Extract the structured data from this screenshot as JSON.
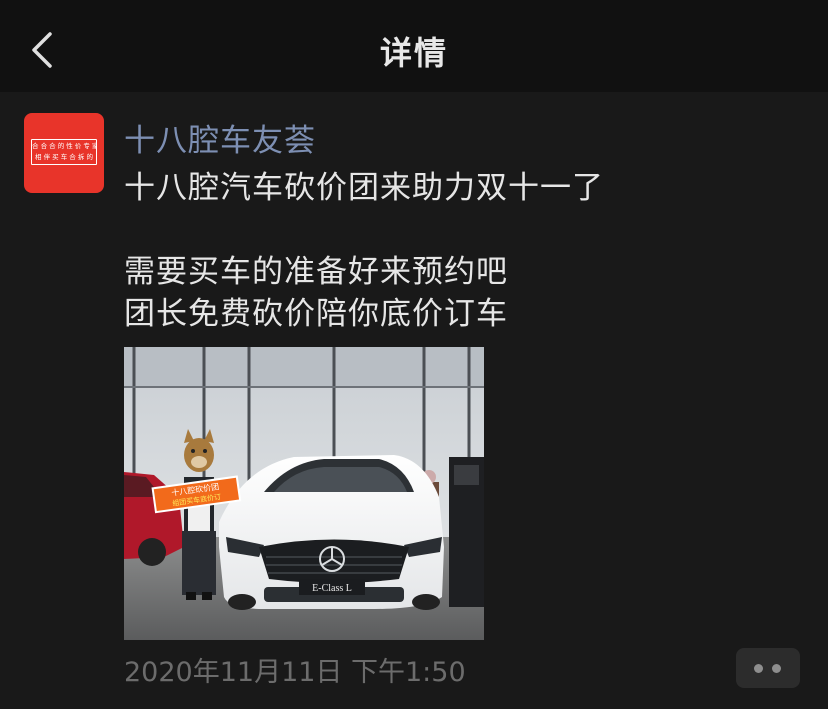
{
  "nav": {
    "title": "详情",
    "back_icon": "chevron-left-icon"
  },
  "post": {
    "author": "十八腔车友荟",
    "avatar_text": [
      "合 合 合 的 性 价 专 家",
      "相 伴 买 车 合 拆 的"
    ],
    "text": "十八腔汽车砍价团来助力双十一了\n\n需要买车的准备好来预约吧\n团长免费砍价陪你底价订车",
    "photo": {
      "sign_line1": "十八腔砍价团",
      "sign_line2": "组团买车底价订",
      "plate": "E-Class L"
    },
    "timestamp": "2020年11月11日 下午1:50",
    "more_icon": "more-dots-icon"
  },
  "colors": {
    "background": "#191919",
    "navbar": "#111111",
    "author": "#7d8fb3",
    "avatar_red": "#e8342a"
  }
}
